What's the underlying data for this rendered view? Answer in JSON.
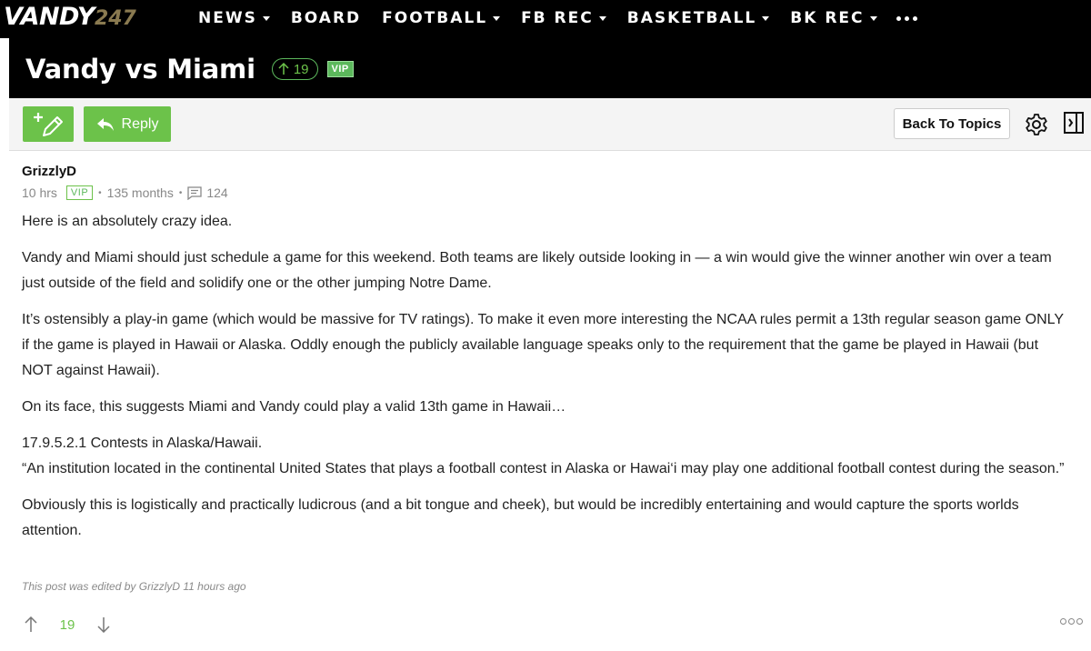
{
  "brand": {
    "logo_text": "VANDY",
    "logo_num": "247",
    "accent": "#6cc24a"
  },
  "nav": {
    "items": [
      {
        "label": "NEWS",
        "dropdown": true
      },
      {
        "label": "BOARD",
        "dropdown": false
      },
      {
        "label": "FOOTBALL",
        "dropdown": true
      },
      {
        "label": "FB REC",
        "dropdown": true
      },
      {
        "label": "BASKETBALL",
        "dropdown": true
      },
      {
        "label": "BK REC",
        "dropdown": true
      }
    ],
    "more_icon": "ellipsis-icon"
  },
  "thread": {
    "title": "Vandy vs Miami",
    "votes": "19",
    "vip_label": "VIP"
  },
  "toolbar": {
    "new_post_icon": "new-post-icon",
    "reply_label": "Reply",
    "back_label": "Back To Topics",
    "settings_icon": "gear-icon",
    "panel_icon": "panel-toggle-icon"
  },
  "post": {
    "author": "GrizzlyD",
    "time": "10 hrs",
    "vip_label": "VIP",
    "member_age": "135 months",
    "comment_count": "124",
    "paragraphs": [
      "Here is an absolutely crazy idea.",
      "Vandy and Miami should just schedule a game for this weekend. Both teams are likely outside looking in — a win would give the winner another win over a team just outside of the field and solidify one or the other jumping Notre Dame.",
      "It’s ostensibly a play-in game (which would be massive for TV ratings). To make it even more interesting the NCAA rules permit a 13th regular season game ONLY if the game is played in Hawaii or Alaska. Oddly enough the publicly available language speaks only to the requirement that the game be played in Hawaii (but NOT against Hawaii).",
      "On its face, this suggests Miami and Vandy could play a valid 13th game in Hawaii…",
      "17.9.5.2.1 Contests in Alaska/Hawaii.\n“An institution located in the continental United States that plays a football contest in Alaska or Hawai‘i may play one additional football contest during the season.”",
      "Obviously this is logistically and practically ludicrous (and a bit tongue and cheek), but would be incredibly entertaining and would capture the sports worlds attention."
    ],
    "edited_note": "This post was edited by GrizzlyD 11 hours ago",
    "score": "19"
  }
}
